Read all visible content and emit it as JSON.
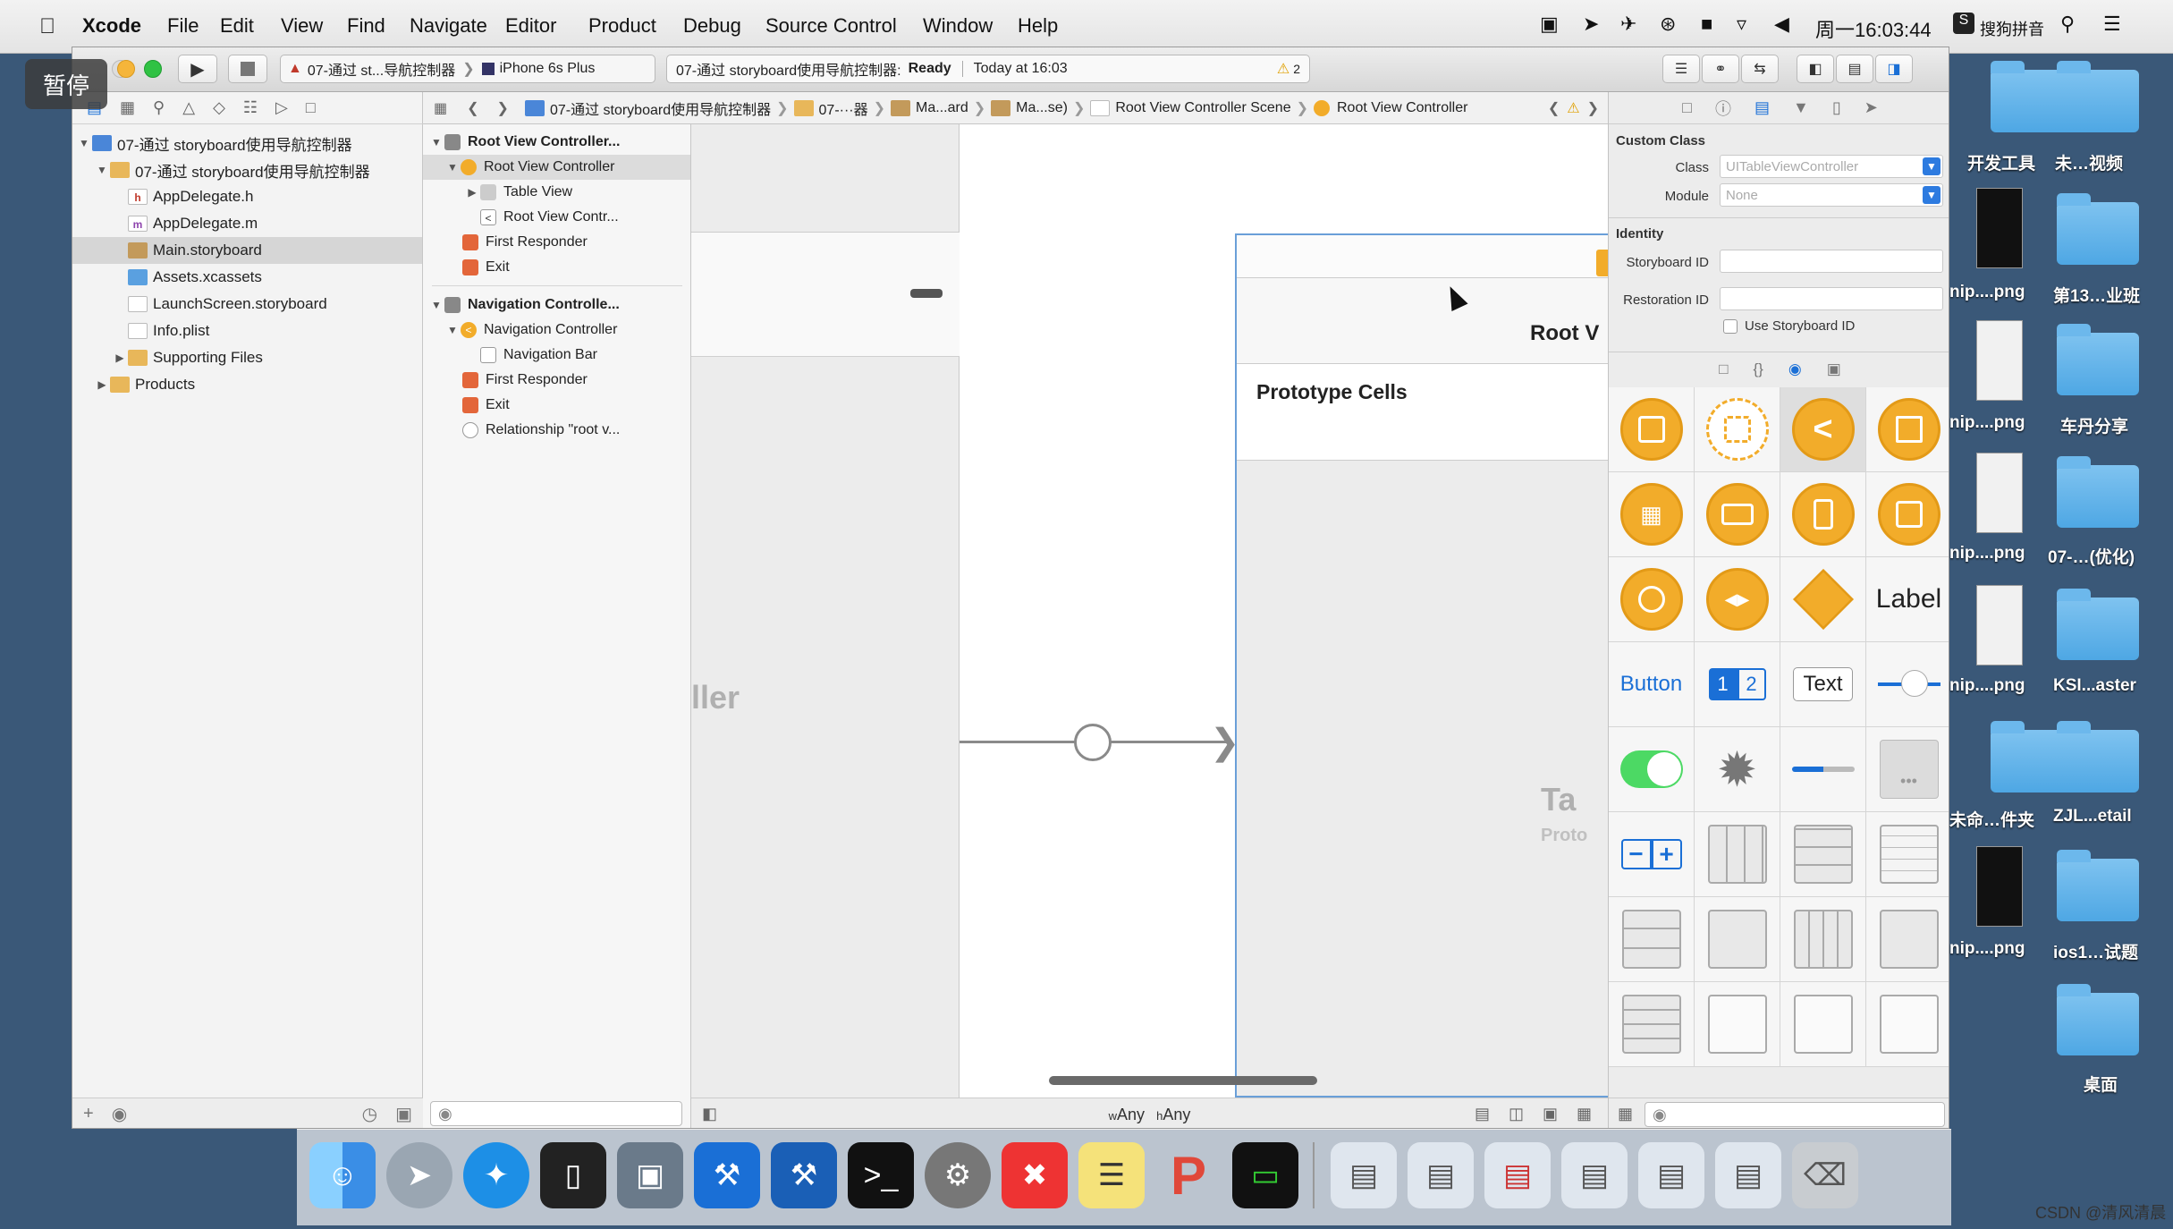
{
  "menubar": {
    "app": "Xcode",
    "items": [
      "File",
      "Edit",
      "View",
      "Find",
      "Navigate",
      "Editor",
      "Product",
      "Debug",
      "Source Control",
      "Window",
      "Help"
    ],
    "clock": "周一16:03:44",
    "input_method": "搜狗拼音"
  },
  "overlay": {
    "pause_label": "暂停"
  },
  "toolbar": {
    "scheme": "07-通过 st...导航控制器",
    "device": "iPhone 6s Plus",
    "status_project": "07-通过 storyboard使用导航控制器:",
    "status_state": "Ready",
    "status_time": "Today at 16:03",
    "warning_count": "2"
  },
  "navigator": {
    "items": [
      {
        "label": "07-通过 storyboard使用导航控制器",
        "icon": "project-icon"
      },
      {
        "label": "07-通过 storyboard使用导航控制器",
        "icon": "folder-icon"
      },
      {
        "label": "AppDelegate.h",
        "icon": "h-file-icon"
      },
      {
        "label": "AppDelegate.m",
        "icon": "m-file-icon"
      },
      {
        "label": "Main.storyboard",
        "icon": "storyboard-icon"
      },
      {
        "label": "Assets.xcassets",
        "icon": "assets-icon"
      },
      {
        "label": "LaunchScreen.storyboard",
        "icon": "storyboard-icon"
      },
      {
        "label": "Info.plist",
        "icon": "plist-icon"
      },
      {
        "label": "Supporting Files",
        "icon": "folder-icon"
      },
      {
        "label": "Products",
        "icon": "folder-icon"
      }
    ]
  },
  "jumpbar": {
    "crumbs": [
      "07-通过 storyboard使用导航控制器",
      "07-···器",
      "Ma...ard",
      "Ma...se)",
      "Root View Controller Scene",
      "Root View Controller"
    ]
  },
  "outline": {
    "items": [
      {
        "label": "Root View Controller..."
      },
      {
        "label": "Root View Controller"
      },
      {
        "label": "Table View"
      },
      {
        "label": "Root View Contr..."
      },
      {
        "label": "First Responder"
      },
      {
        "label": "Exit"
      },
      {
        "label": "Navigation Controlle..."
      },
      {
        "label": "Navigation Controller"
      },
      {
        "label": "Navigation Bar"
      },
      {
        "label": "First Responder"
      },
      {
        "label": "Exit"
      },
      {
        "label": "Relationship \"root v..."
      }
    ]
  },
  "canvas": {
    "left_scene_title": "ller",
    "right_nav_title": "Root V",
    "prototype_cells": "Prototype Cells",
    "right_partial_title": "Ta",
    "right_partial_sub": "Proto",
    "size_class_w": "w",
    "size_class_any1": "Any",
    "size_class_h": "h",
    "size_class_any2": "Any"
  },
  "inspector": {
    "custom_class_header": "Custom Class",
    "class_label": "Class",
    "class_placeholder": "UITableViewController",
    "module_label": "Module",
    "module_value": "None",
    "identity_header": "Identity",
    "storyboard_id_label": "Storyboard ID",
    "restoration_id_label": "Restoration ID",
    "use_storyboard_id": "Use Storyboard ID",
    "library_label_text": "Label",
    "library_button_text": "Button",
    "library_text_text": "Text",
    "segment_1": "1",
    "segment_2": "2"
  },
  "desktop": {
    "items": [
      {
        "label": "开发工具"
      },
      {
        "label": "未…视频"
      },
      {
        "label": "nip....png"
      },
      {
        "label": "第13…业班"
      },
      {
        "label": "nip....png"
      },
      {
        "label": "车丹分享"
      },
      {
        "label": "nip....png"
      },
      {
        "label": "07-…(优化)"
      },
      {
        "label": "nip....png"
      },
      {
        "label": "KSI...aster"
      },
      {
        "label": "未命…件夹"
      },
      {
        "label": "ZJL...etail"
      },
      {
        "label": "nip....png"
      },
      {
        "label": "ios1…试题"
      },
      {
        "label": "桌面"
      }
    ]
  },
  "watermark": "CSDN @清风清晨"
}
